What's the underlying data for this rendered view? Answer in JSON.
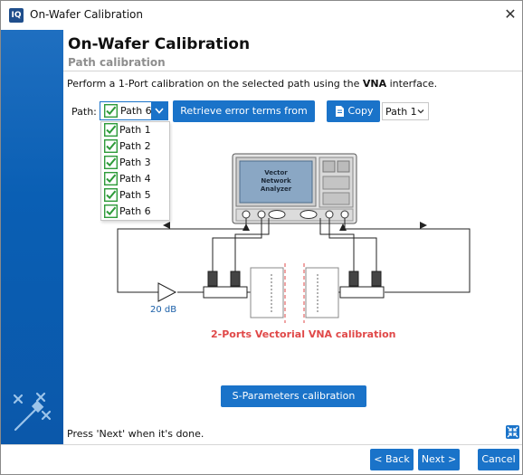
{
  "window": {
    "title": "On-Wafer Calibration",
    "app_icon": "IQ",
    "close_glyph": "✕"
  },
  "header": {
    "title": "On-Wafer Calibration",
    "subtitle": "Path calibration"
  },
  "instruction": {
    "before": "Perform a 1-Port calibration on the selected path using the ",
    "bold": "VNA",
    "after": " interface."
  },
  "path_select": {
    "label": "Path:",
    "value": "Path 6",
    "options": [
      "Path 1",
      "Path 2",
      "Path 3",
      "Path 4",
      "Path 5",
      "Path 6"
    ]
  },
  "buttons": {
    "retrieve": "Retrieve error terms from VNA",
    "copy": "Copy",
    "sparam_check": "S-Parameters calibration check",
    "back": "< Back",
    "next": "Next >",
    "cancel": "Cancel"
  },
  "copy_target": {
    "value": "Path 1"
  },
  "diagram": {
    "vna_label": [
      "Vector",
      "Network",
      "Analyzer"
    ],
    "gain_label": "20 dB",
    "caption": "2-Ports Vectorial VNA calibration"
  },
  "footer_hint": "Press 'Next' when it's done.",
  "colors": {
    "accent": "#1a73c9",
    "sidebar": "#0b5fb4",
    "caption": "#e04848",
    "check": "#2e9b3a"
  },
  "icons": [
    "app-icon",
    "close-icon",
    "wand-icon",
    "check-icon",
    "chevron-down-icon",
    "copy-icon",
    "collapse-icon"
  ]
}
